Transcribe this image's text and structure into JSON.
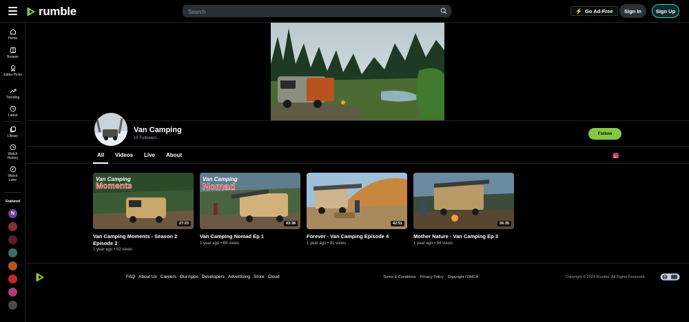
{
  "header": {
    "logo_text": "rumble",
    "search_placeholder": "Search",
    "adfree_label": "Go Ad-Free",
    "signin_label": "Sign In",
    "signup_label": "Sign Up"
  },
  "sidebar": {
    "items": [
      {
        "label": "Home",
        "icon": "home-icon"
      },
      {
        "label": "Browse",
        "icon": "browse-icon"
      },
      {
        "label": "Editor Picks",
        "icon": "medal-icon"
      },
      {
        "label": "Trending",
        "icon": "trending-icon"
      },
      {
        "label": "Latest",
        "icon": "clock-icon"
      },
      {
        "label": "Library",
        "icon": "library-icon"
      },
      {
        "label": "Watch History",
        "icon": "history-icon"
      },
      {
        "label": "Watch Later",
        "icon": "watch-later-icon"
      }
    ],
    "featured_label": "Featured",
    "featured": [
      {
        "letter": "N",
        "color": "#6b3fa0"
      },
      {
        "letter": "",
        "color": "#8b2c3a"
      },
      {
        "letter": "",
        "color": "#5a1f2a"
      },
      {
        "letter": "",
        "color": "#3b6f6a"
      },
      {
        "letter": "",
        "color": "#b3541e"
      },
      {
        "letter": "",
        "color": "#c8262b"
      },
      {
        "letter": "",
        "color": "#a83c7a"
      },
      {
        "letter": "",
        "color": "#4a4a4a"
      }
    ]
  },
  "channel": {
    "name": "Van Camping",
    "followers": "19 Followers",
    "follow_label": "Follow"
  },
  "tabs": [
    {
      "label": "All",
      "active": true
    },
    {
      "label": "Videos",
      "active": false
    },
    {
      "label": "Live",
      "active": false
    },
    {
      "label": "About",
      "active": false
    }
  ],
  "videos": [
    {
      "title": "Van Camping Moments - Season 2 Episode 2",
      "meta": "1 year ago • 92 views",
      "duration": "27:23",
      "overlay_top": "Van Camping",
      "overlay_main": "Moments"
    },
    {
      "title": "Van Camping Nomad Ep 1",
      "meta": "1 year ago • 69 views",
      "duration": "43:38",
      "overlay_top": "Van Camping",
      "overlay_main": "Nomad"
    },
    {
      "title": "Forever - Van Camping Episode 4",
      "meta": "1 year ago • 91 views",
      "duration": "42:51",
      "overlay_top": "",
      "overlay_main": ""
    },
    {
      "title": "Mother Nature - Van Camping Ep 3",
      "meta": "1 year ago • 56 views",
      "duration": "36:35",
      "overlay_top": "",
      "overlay_main": ""
    }
  ],
  "footer": {
    "links": [
      "FAQ",
      "About Us",
      "Careers",
      "Our Apps",
      "Developers",
      "Advertising",
      "Store",
      "Cloud"
    ],
    "legal": [
      "Terms & Conditions",
      "Privacy Policy",
      "Copyright / DMCA"
    ],
    "copyright": "Copyright © 2024 Rumble. All Rights Reserved."
  },
  "colors": {
    "brand_green": "#85c742",
    "signup_border": "#36d3c2",
    "background": "#000000"
  }
}
